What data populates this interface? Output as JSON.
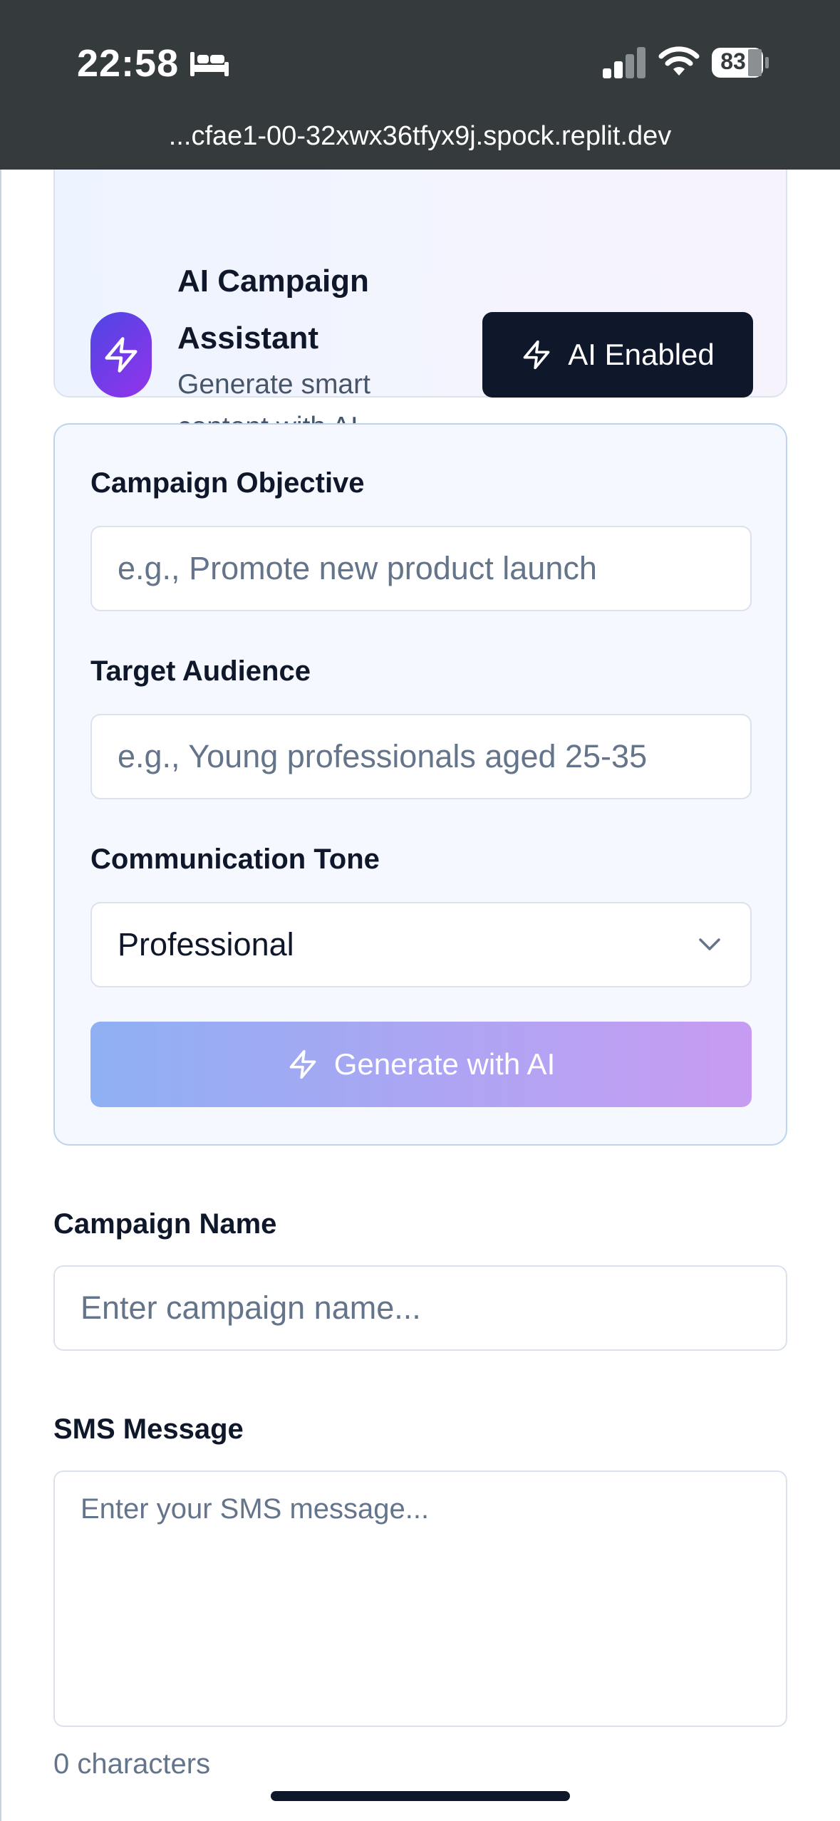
{
  "status_bar": {
    "time": "22:58",
    "battery": "83",
    "url": "...cfae1-00-32xwx36tfyx9j.spock.replit.dev"
  },
  "ai_card": {
    "title_line1": "AI Campaign",
    "title_line2": "Assistant",
    "subtitle_line1": "Generate smart",
    "subtitle_line2": "content with AI",
    "enabled_label": "AI Enabled",
    "badge_icon": "lightning-icon"
  },
  "ai_form": {
    "objective_label": "Campaign Objective",
    "objective_placeholder": "e.g., Promote new product launch",
    "audience_label": "Target Audience",
    "audience_placeholder": "e.g., Young professionals aged 25-35",
    "tone_label": "Communication Tone",
    "tone_value": "Professional",
    "generate_label": "Generate with AI"
  },
  "campaign_form": {
    "name_label": "Campaign Name",
    "name_placeholder": "Enter campaign name...",
    "sms_label": "SMS Message",
    "sms_placeholder": "Enter your SMS message...",
    "char_count": "0 characters"
  },
  "colors": {
    "status_bar_bg": "#353a3d",
    "dark_button": "#0f172a",
    "gradient_start": "#8fb0f4",
    "gradient_end": "#c79bf2",
    "badge_gradient_start": "#4f46e5",
    "badge_gradient_end": "#9333ea"
  }
}
